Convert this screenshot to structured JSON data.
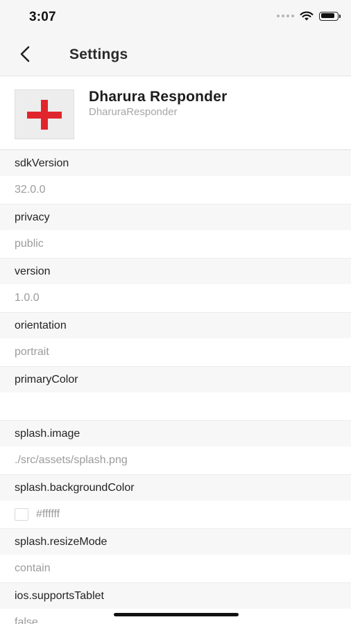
{
  "status_bar": {
    "time": "3:07",
    "battery_level": 0.9
  },
  "nav": {
    "title": "Settings",
    "back_icon": "chevron-left-icon"
  },
  "app": {
    "name": "Dharura Responder",
    "slug": "DharuraResponder",
    "icon": "red-cross-icon",
    "icon_color": "#e0262c"
  },
  "settings": [
    {
      "key": "sdkVersion",
      "value": "32.0.0"
    },
    {
      "key": "privacy",
      "value": "public"
    },
    {
      "key": "version",
      "value": "1.0.0"
    },
    {
      "key": "orientation",
      "value": "portrait"
    },
    {
      "key": "primaryColor",
      "value": ""
    },
    {
      "key": "splash.image",
      "value": "./src/assets/splash.png"
    },
    {
      "key": "splash.backgroundColor",
      "value": "#ffffff",
      "swatch": "#ffffff"
    },
    {
      "key": "splash.resizeMode",
      "value": "contain"
    },
    {
      "key": "ios.supportsTablet",
      "value": "false"
    }
  ]
}
